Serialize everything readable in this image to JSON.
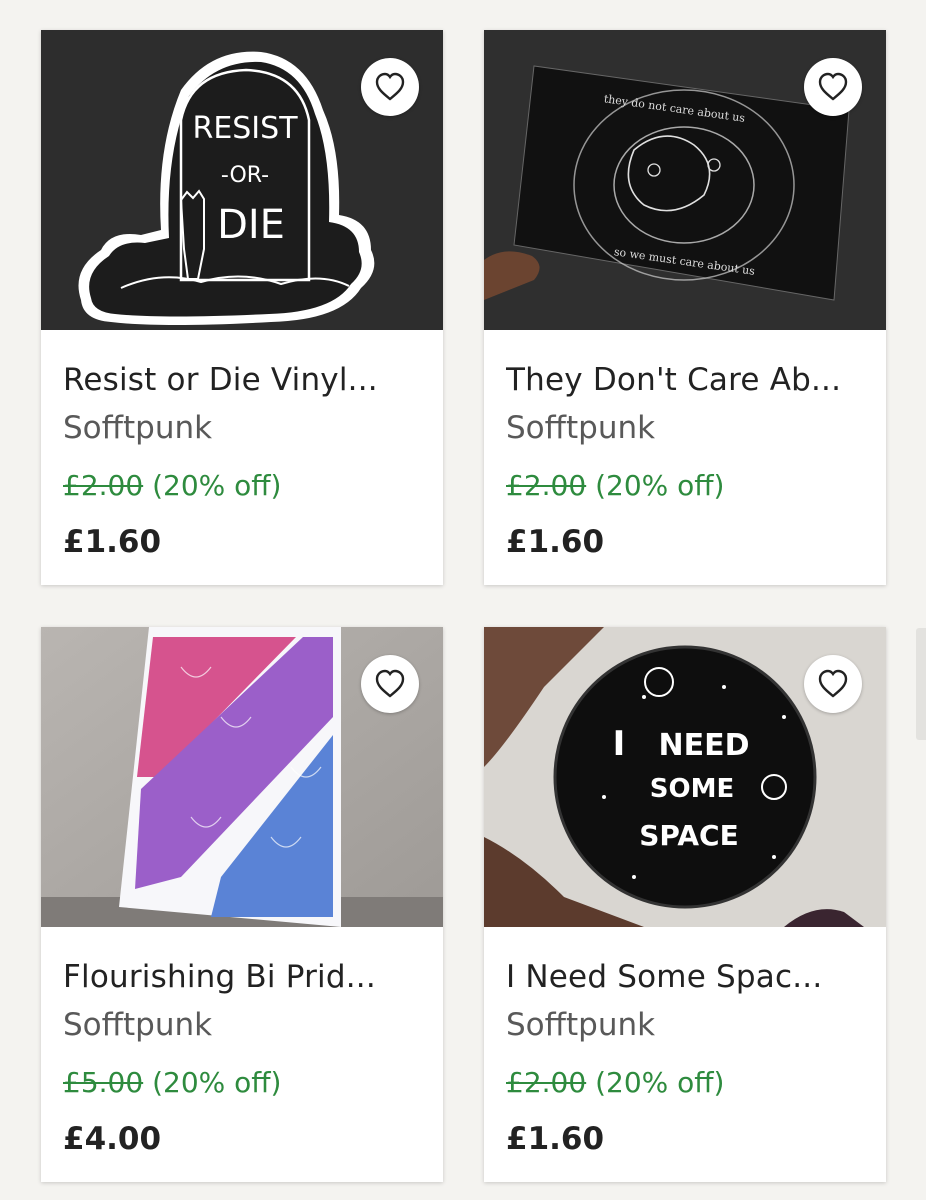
{
  "listings": [
    {
      "title": "Resist or Die  Vinyl...",
      "shop": "Sofftpunk",
      "original_price": "£2.00",
      "discount": "(20% off)",
      "price": "£1.60",
      "image_text": "RESIST -OR- DIE"
    },
    {
      "title": "They Don't Care Ab...",
      "shop": "Sofftpunk",
      "original_price": "£2.00",
      "discount": "(20% off)",
      "price": "£1.60",
      "image_text": "they do not care about us / so we must care about us"
    },
    {
      "title": "Flourishing  Bi Prid...",
      "shop": "Sofftpunk",
      "original_price": "£5.00",
      "discount": "(20% off)",
      "price": "£4.00"
    },
    {
      "title": "I Need Some Spac...",
      "shop": "Sofftpunk",
      "original_price": "£2.00",
      "discount": "(20% off)",
      "price": "£1.60",
      "image_text": "I NEED SOME SPACE"
    }
  ],
  "icons": {
    "favorite": "heart-outline-icon"
  },
  "colors": {
    "discount_green": "#2e8b3e",
    "background": "#f4f3f0"
  }
}
